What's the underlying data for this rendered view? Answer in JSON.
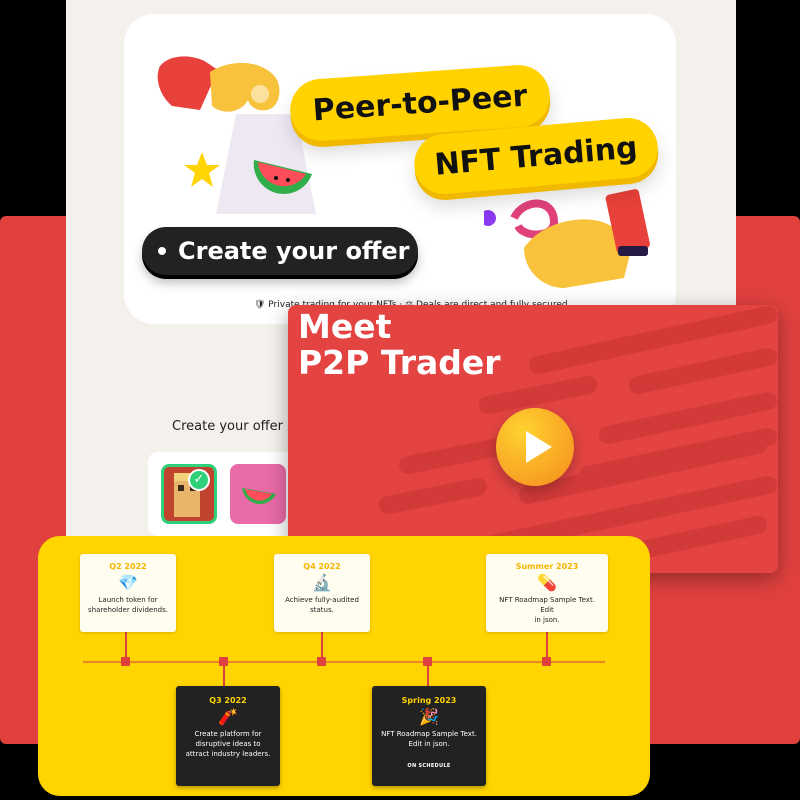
{
  "hero": {
    "headline_line1": "Peer-to-Peer",
    "headline_line2": "NFT Trading",
    "cta_label": "Create your offer",
    "caption": "🛡 Private trading for your NFTs · ⚖ Deals are direct and fully secured"
  },
  "offer_section": {
    "label": "Create your offer"
  },
  "video": {
    "title_line1": "Meet",
    "title_line2": "P2P Trader",
    "play_icon": "play-icon"
  },
  "roadmap": {
    "milestones": [
      {
        "period": "Q2 2022",
        "icon": "💎",
        "text_line1": "Launch token for",
        "text_line2": "shareholder dividends.",
        "status": ""
      },
      {
        "period": "Q3 2022",
        "icon": "🧨",
        "text_line1": "Create platform for",
        "text_line2": "disruptive ideas to",
        "text_line3": "attract industry leaders.",
        "status": ""
      },
      {
        "period": "Q4 2022",
        "icon": "🔬",
        "text_line1": "Achieve fully-audited",
        "text_line2": "status.",
        "status": ""
      },
      {
        "period": "Spring 2023",
        "icon": "🎉",
        "text_line1": "NFT Roadmap Sample Text.",
        "text_line2": "Edit in json.",
        "status": "ON SCHEDULE"
      },
      {
        "period": "Summer 2023",
        "icon": "💊",
        "text_line1": "NFT Roadmap Sample Text. Edit",
        "text_line2": "in json.",
        "status": ""
      }
    ]
  },
  "colors": {
    "brand_red": "#e0413f",
    "brand_yellow": "#ffd400",
    "dark": "#222222"
  }
}
